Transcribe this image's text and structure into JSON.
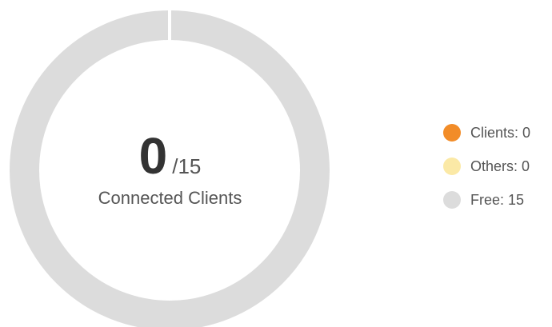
{
  "summary": {
    "connected_count": "0",
    "total": "/15",
    "label": "Connected Clients"
  },
  "legend": [
    {
      "name": "Clients",
      "text": "Clients: 0",
      "color": "#f28c28"
    },
    {
      "name": "Others",
      "text": "Others: 0",
      "color": "#fbe9a6"
    },
    {
      "name": "Free",
      "text": "Free: 15",
      "color": "#dcdcdc"
    }
  ],
  "chart_data": {
    "type": "pie",
    "categories": [
      "Clients",
      "Others",
      "Free"
    ],
    "values": [
      0,
      0,
      15
    ],
    "colors": [
      "#f28c28",
      "#fbe9a6",
      "#dcdcdc"
    ]
  }
}
